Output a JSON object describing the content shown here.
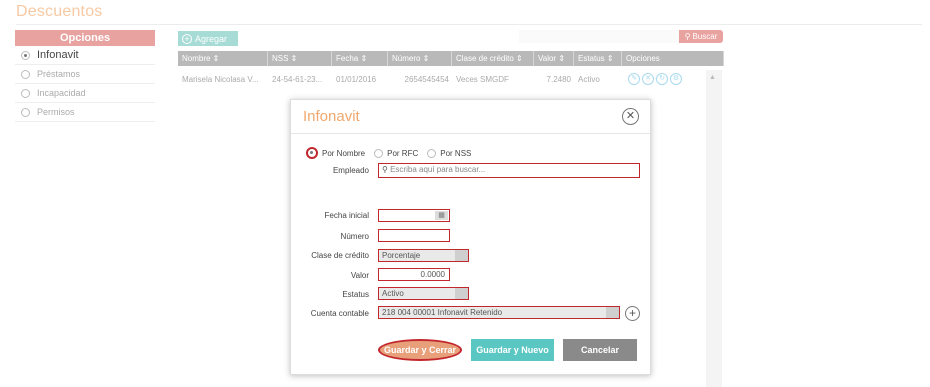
{
  "page": {
    "title": "Descuentos"
  },
  "sidebar": {
    "header": "Opciones",
    "items": [
      {
        "label": "Infonavit",
        "selected": true
      },
      {
        "label": "Préstamos",
        "selected": false
      },
      {
        "label": "Incapacidad",
        "selected": false
      },
      {
        "label": "Permisos",
        "selected": false
      }
    ]
  },
  "toolbar": {
    "add_label": "Agregar",
    "add_icon": "plus-circle-icon",
    "search_label": "Buscar",
    "search_icon": "search-icon"
  },
  "table": {
    "columns": [
      "Nombre",
      "NSS",
      "Fecha",
      "Número",
      "Clase de crédito",
      "Valor",
      "Estatus",
      "Opciones"
    ],
    "rows": [
      {
        "nombre": "Marisela Nicolasa V...",
        "nss": "24-54-61-23...",
        "fecha": "01/01/2016",
        "numero": "2654545454",
        "clase": "Veces SMGDF",
        "valor": "7.2480",
        "estatus": "Activo"
      }
    ],
    "row_actions": [
      "edit-icon",
      "delete-icon",
      "refresh-icon",
      "settings-icon"
    ]
  },
  "modal": {
    "title": "Infonavit",
    "close_icon": "close-icon",
    "search_by": [
      "Por Nombre",
      "Por RFC",
      "Por NSS"
    ],
    "search_by_selected": "Por Nombre",
    "labels": {
      "empleado": "Empleado",
      "fecha_inicial": "Fecha inicial",
      "numero": "Número",
      "clase_credito": "Clase de crédito",
      "valor": "Valor",
      "estatus": "Estatus",
      "cuenta_contable": "Cuenta contable"
    },
    "fields": {
      "empleado_placeholder": "Escriba aquí para buscar...",
      "fecha_inicial": "",
      "numero": "",
      "clase_credito": "Porcentaje",
      "valor": "0.0000",
      "estatus": "Activo",
      "cuenta_contable": "218 004 00001 Infonavit Retenido"
    },
    "buttons": {
      "save_close": "Guardar y Cerrar",
      "save_new": "Guardar y Nuevo",
      "cancel": "Cancelar"
    },
    "highlight_color": "#c1272d"
  },
  "colors": {
    "accent": "#e8a3a0",
    "teal": "#5bc7c3",
    "title": "#f0a86e"
  }
}
